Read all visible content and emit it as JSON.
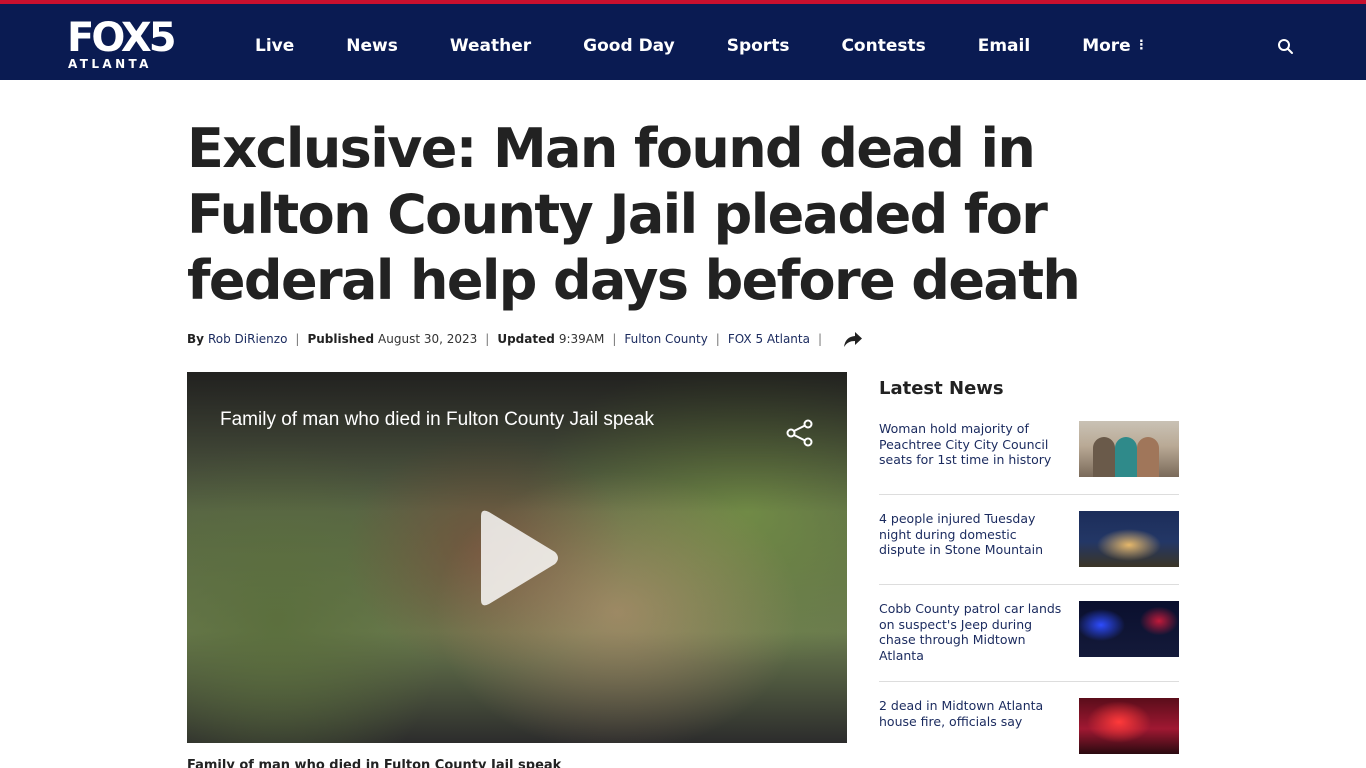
{
  "site": {
    "logo_main": "FOX5",
    "logo_sub": "ATLANTA",
    "colors": {
      "nav_bg": "#0a1b52",
      "accent_red": "#c8102e",
      "link": "#1a2a5e"
    }
  },
  "nav": {
    "items": [
      "Live",
      "News",
      "Weather",
      "Good Day",
      "Sports",
      "Contests",
      "Email"
    ],
    "more_label": "More",
    "search_icon": "search-icon"
  },
  "article": {
    "headline": "Exclusive: Man found dead in Fulton County Jail pleaded for federal help days before death",
    "byline": {
      "by_label": "By",
      "author": "Rob DiRienzo",
      "published_label": "Published",
      "published_date": "August 30, 2023",
      "updated_label": "Updated",
      "updated_time": "9:39AM",
      "category": "Fulton County",
      "source": "FOX 5 Atlanta",
      "separator": "|"
    },
    "video": {
      "title": "Family of man who died in Fulton County Jail speak",
      "share_icon": "share-icon",
      "play_icon": "play-icon"
    },
    "caption": "Family of man who died in Fulton County Jail speak"
  },
  "sidebar": {
    "title": "Latest News",
    "items": [
      {
        "headline": "Woman hold majority of Peachtree City City Council seats for 1st time in history"
      },
      {
        "headline": "4 people injured Tuesday night during domestic dispute in Stone Mountain"
      },
      {
        "headline": "Cobb County patrol car lands on suspect's Jeep during chase through Midtown Atlanta"
      },
      {
        "headline": "2 dead in Midtown Atlanta house fire, officials say"
      }
    ]
  }
}
